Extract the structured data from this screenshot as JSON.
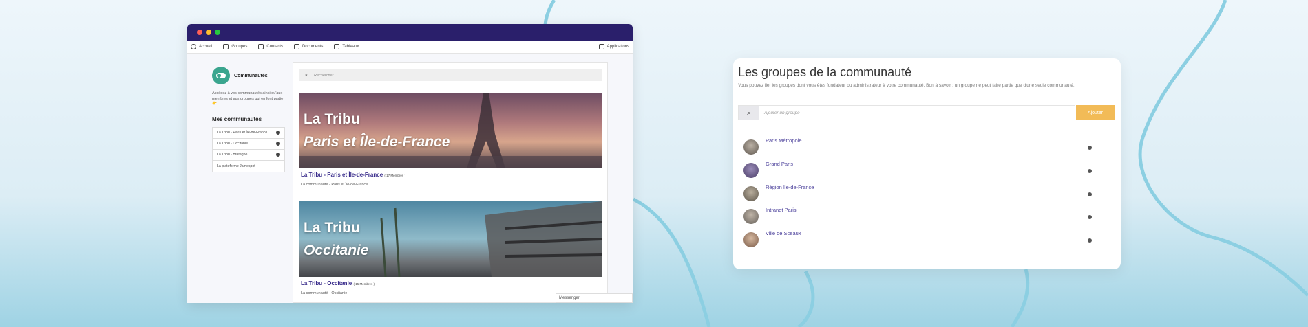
{
  "colors": {
    "titlebar": "#2a1f6b",
    "accent_link": "#3b2e8c",
    "add_button": "#f2bb57",
    "community_logo": "#3aa58e",
    "traffic": [
      "#ff5f56",
      "#ffbd2e",
      "#27c93f"
    ]
  },
  "topnav": {
    "items": [
      {
        "label": "Accueil",
        "icon": "globe-icon"
      },
      {
        "label": "Groupes",
        "icon": "groups-icon"
      },
      {
        "label": "Contacts",
        "icon": "contacts-icon"
      },
      {
        "label": "Documents",
        "icon": "documents-icon"
      },
      {
        "label": "Tableaux",
        "icon": "boards-icon"
      }
    ],
    "apps_label": "Applications"
  },
  "sidebar": {
    "title": "Communautés",
    "description": "Accédez à vos communautés ainsi qu'aux membres et aux groupes qui en font partie 👉",
    "my_title": "Mes communautés",
    "items": [
      {
        "label": "La Tribu - Paris et Île-de-France"
      },
      {
        "label": "La Tribu - Occitanie"
      },
      {
        "label": "La Tribu - Bretagne"
      },
      {
        "label": "La plateforme Jamespot"
      }
    ]
  },
  "feed": {
    "search_placeholder": "Rechercher",
    "cards": [
      {
        "banner_line1": "La Tribu",
        "banner_line2": "Paris et Île-de-France",
        "title": "La Tribu - Paris et Île-de-France",
        "members": "( 17 Membres )",
        "description": "La communauté - Paris et Île-de-France"
      },
      {
        "banner_line1": "La Tribu",
        "banner_line2": "Occitanie",
        "title": "La Tribu - Occitanie",
        "members": "( 15 Membres )",
        "description": "La communauté - Occitanie"
      }
    ],
    "messenger_label": "Messenger"
  },
  "panel": {
    "title": "Les groupes de la communauté",
    "description": "Vous pouvez lier les groupes dont vous êtes fondateur ou administrateur à votre communauté. Bon à savoir : un groupe ne peut faire partie que d'une seule communauté.",
    "search_placeholder": "Ajouter un groupe",
    "add_label": "Ajouter",
    "groups": [
      {
        "name": "Paris Métropole"
      },
      {
        "name": "Grand Paris"
      },
      {
        "name": "Région Ile-de-France"
      },
      {
        "name": "Intranet Paris"
      },
      {
        "name": "Ville de Sceaux"
      }
    ]
  }
}
